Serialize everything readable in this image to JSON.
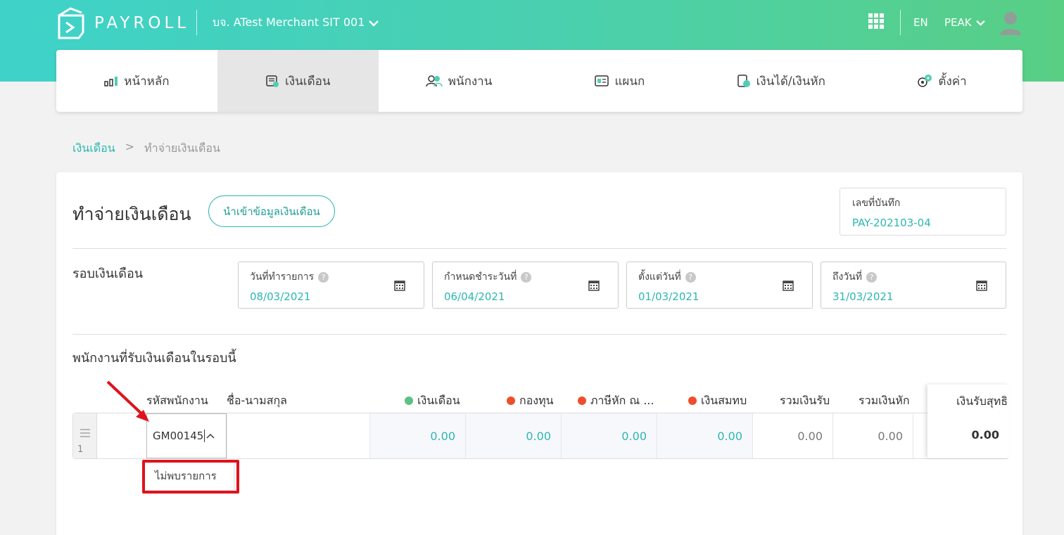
{
  "app": {
    "brand": "PAYROLL",
    "company": "บจ. ATest Merchant SIT 001",
    "language": "EN",
    "user": "PEAK"
  },
  "nav": {
    "items": [
      {
        "label": "หน้าหลัก",
        "icon": "chart-icon"
      },
      {
        "label": "เงินเดือน",
        "icon": "salary-icon"
      },
      {
        "label": "พนักงาน",
        "icon": "employees-icon"
      },
      {
        "label": "แผนก",
        "icon": "department-icon"
      },
      {
        "label": "เงินได้/เงินหัก",
        "icon": "income-deduction-icon"
      },
      {
        "label": "ตั้งค่า",
        "icon": "gears-icon"
      }
    ],
    "active_index": 1
  },
  "breadcrumb": {
    "parent": "เงินเดือน",
    "separator": ">",
    "current": "ทำจ่ายเงินเดือน"
  },
  "page": {
    "title": "ทำจ่ายเงินเดือน",
    "import_button": "นำเข้าข้อมูลเงินเดือน",
    "doc_no_label": "เลขที่บันทึก",
    "doc_no_value": "PAY-202103-04"
  },
  "period": {
    "title": "รอบเงินเดือน",
    "fields": [
      {
        "label": "วันที่ทำรายการ",
        "value": "08/03/2021"
      },
      {
        "label": "กำหนดชำระวันที่",
        "value": "06/04/2021"
      },
      {
        "label": "ตั้งแต่วันที่",
        "value": "01/03/2021"
      },
      {
        "label": "ถึงวันที่",
        "value": "31/03/2021"
      }
    ],
    "help_glyph": "?"
  },
  "employees": {
    "title": "พนักงานที่รับเงินเดือนในรอบนี้",
    "columns": {
      "code": "รหัสพนักงาน",
      "name": "ชื่อ-นามสกุล",
      "salary": "เงินเดือน",
      "fund": "กองทุน",
      "tax": "ภาษีหัก ณ ...",
      "social": "เงินสมทบ",
      "total_income": "รวมเงินรับ",
      "total_deduct": "รวมเงินหัก",
      "net": "เงินรับสุทธิ"
    },
    "status_colors": {
      "salary": "#5cc184",
      "fund": "#ee4e2b",
      "tax": "#ee4e2b",
      "social": "#ee4e2b"
    },
    "row": {
      "index": "1",
      "code_input": "GM00145",
      "salary": "0.00",
      "fund": "0.00",
      "tax": "0.00",
      "social": "0.00",
      "total_income": "0.00",
      "total_deduct": "0.00",
      "net": "0.00"
    },
    "dropdown_empty": "ไม่พบรายการ"
  }
}
